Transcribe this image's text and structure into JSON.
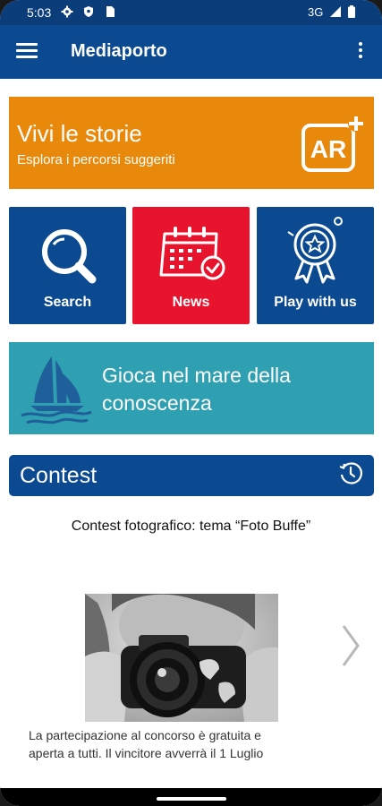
{
  "status_bar": {
    "time": "5:03",
    "network": "3G",
    "icons": [
      "settings-icon",
      "shield-icon",
      "sim-card-icon",
      "signal-icon",
      "battery-icon"
    ]
  },
  "app_bar": {
    "title": "Mediaporto",
    "icons": [
      "hamburger-menu-icon",
      "more-vert-icon"
    ]
  },
  "ar_banner": {
    "title": "Vivi le storie",
    "subtitle": "Esplora i percorsi suggeriti",
    "icon_text": "AR",
    "color": "#e8890c"
  },
  "tiles": [
    {
      "label": "Search",
      "icon": "magnifier-icon",
      "color": "#0b4a91"
    },
    {
      "label": "News",
      "icon": "calendar-icon",
      "color": "#e8142d"
    },
    {
      "label": "Play with us",
      "icon": "award-badge-icon",
      "color": "#0b4a91"
    }
  ],
  "sea_banner": {
    "line1": "Gioca nel mare della",
    "line2": "conoscenza",
    "icon": "sailboat-icon",
    "color": "#2f9fb2"
  },
  "contest": {
    "header": "Contest",
    "header_icon": "history-icon",
    "item_title": "Contest fotografico: tema “Foto Buffe”",
    "description_line1": "La partecipazione al concorso è gratuita e",
    "description_line2": "aperta a tutti. Il vincitore avverrà il 1 Luglio",
    "next_icon": "chevron-right-icon"
  },
  "colors": {
    "primary": "#0b4a91",
    "status_bar": "#0b3d7a"
  }
}
